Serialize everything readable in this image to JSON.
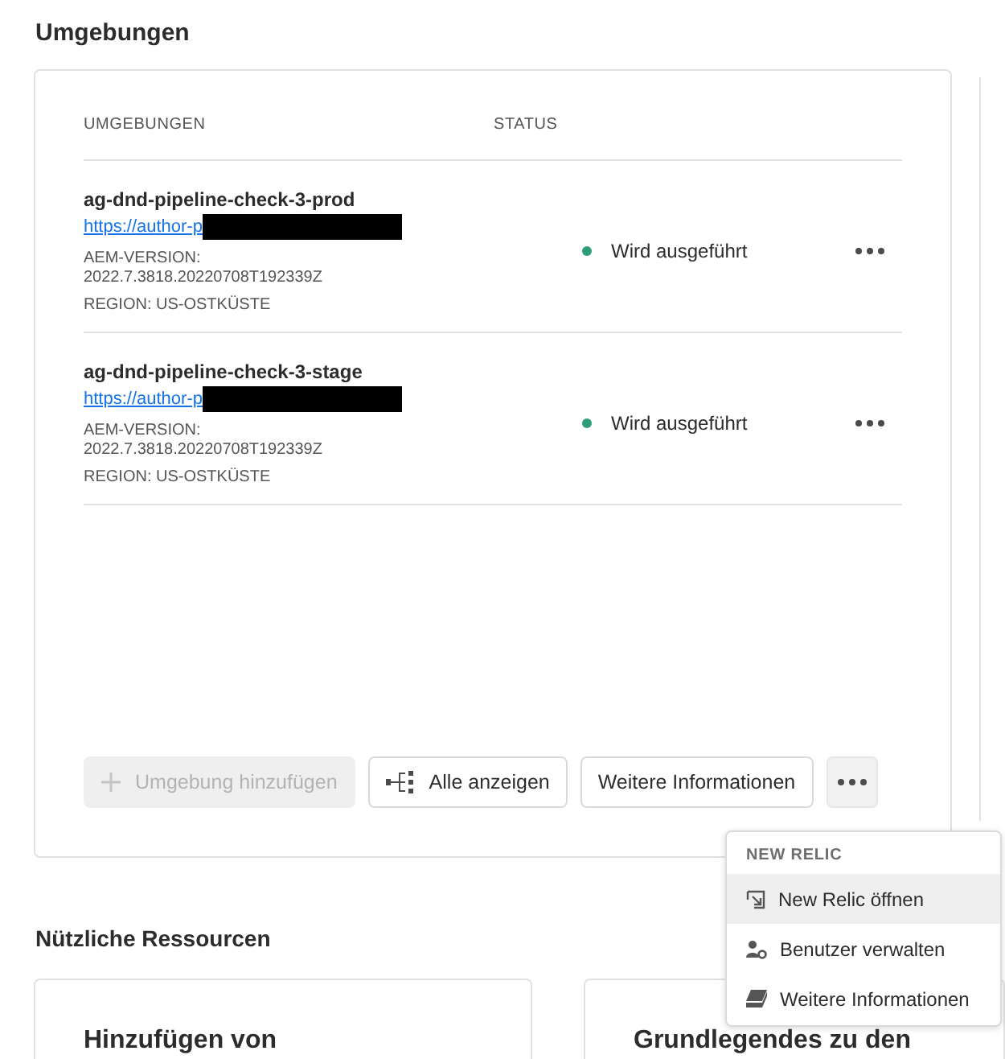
{
  "title": "Umgebungen",
  "table": {
    "columns": [
      "UMGEBUNGEN",
      "STATUS"
    ],
    "rows": [
      {
        "name": "ag-dnd-pipeline-check-3-prod",
        "url": "https://author-p",
        "version_label": "AEM-VERSION:",
        "version": "2022.7.3818.20220708T192339Z",
        "region": "REGION: US-OSTKÜSTE",
        "status": "Wird ausgeführt",
        "color": "#2d9d78"
      },
      {
        "name": "ag-dnd-pipeline-check-3-stage",
        "url": "https://author-p",
        "version_label": "AEM-VERSION:",
        "version": "2022.7.3818.20220708T192339Z",
        "region": "REGION: US-OSTKÜSTE",
        "status": "Wird ausgeführt",
        "color": "#2d9d78"
      }
    ]
  },
  "buttons": [
    {
      "kind": "add",
      "label": "Umgebung hinzufügen",
      "disabled": true
    },
    {
      "kind": "tree",
      "label": "Alle anzeigen",
      "disabled": false
    },
    {
      "kind": "plain",
      "label": "Weitere Informationen",
      "disabled": false
    }
  ],
  "more_menu": {
    "heading": "NEW RELIC",
    "items": [
      {
        "kind": "open",
        "label": "New Relic öffnen",
        "selected": true
      },
      {
        "kind": "users",
        "label": "Benutzer verwalten",
        "selected": false
      },
      {
        "kind": "book",
        "label": "Weitere Informationen",
        "selected": false
      }
    ]
  },
  "resources": {
    "title": "Nützliche Ressourcen",
    "cards": [
      "Hinzufügen von",
      "Grundlegendes zu den"
    ]
  }
}
